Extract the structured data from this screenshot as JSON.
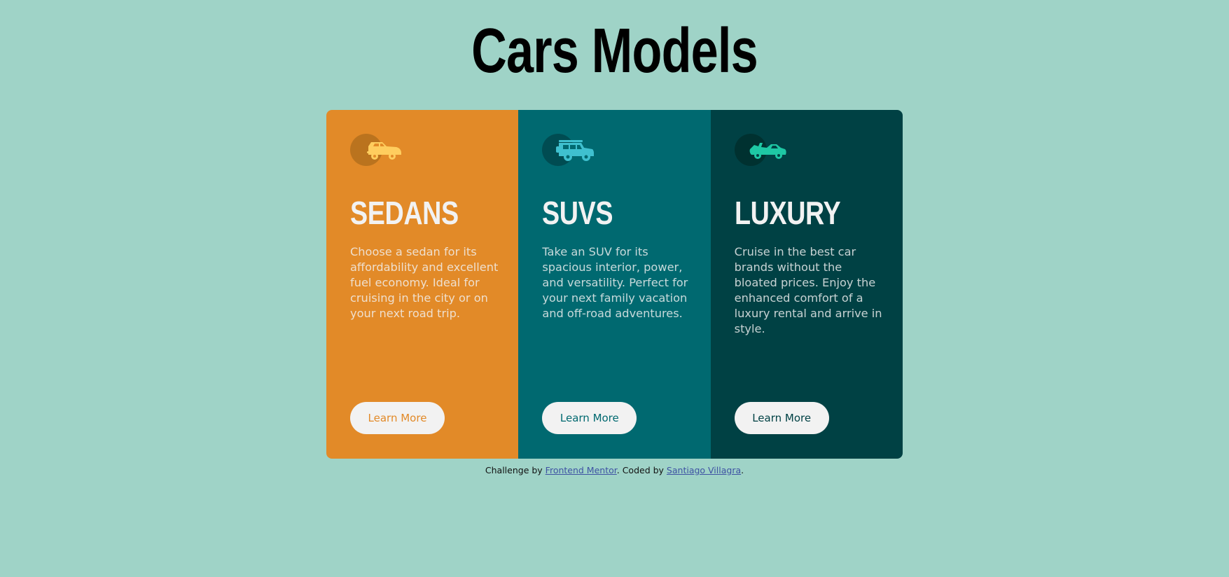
{
  "page": {
    "title": "Cars Models"
  },
  "colors": {
    "background": "#9fd3c7",
    "sedans": "#e28a28",
    "suvs": "#006970",
    "luxury": "#004144",
    "button_bg": "#f2f2f2",
    "icon_sedans": "#ffcd5e",
    "icon_suvs": "#3fc0cf",
    "icon_luxury": "#1ec7a4",
    "link": "#3e52a3"
  },
  "cards": [
    {
      "id": "sedans",
      "icon": "sedan-car-icon",
      "title": "SEDANS",
      "text": "Choose a sedan for its affordability and excellent fuel economy. Ideal for cruising in the city or on your next road trip.",
      "button_label": "Learn More"
    },
    {
      "id": "suvs",
      "icon": "suv-car-icon",
      "title": "SUVS",
      "text": "Take an SUV for its spacious interior, power, and versatility. Perfect for your next family vacation and off-road adventures.",
      "button_label": "Learn More"
    },
    {
      "id": "luxury",
      "icon": "luxury-car-icon",
      "title": "LUXURY",
      "text": "Cruise in the best car brands without the bloated prices. Enjoy the enhanced comfort of a luxury rental and arrive in style.",
      "button_label": "Learn More"
    }
  ],
  "attribution": {
    "prefix": "Challenge by ",
    "link1": "Frontend Mentor",
    "middle": ". Coded by ",
    "link2": "Santiago Villagra",
    "suffix": "."
  }
}
